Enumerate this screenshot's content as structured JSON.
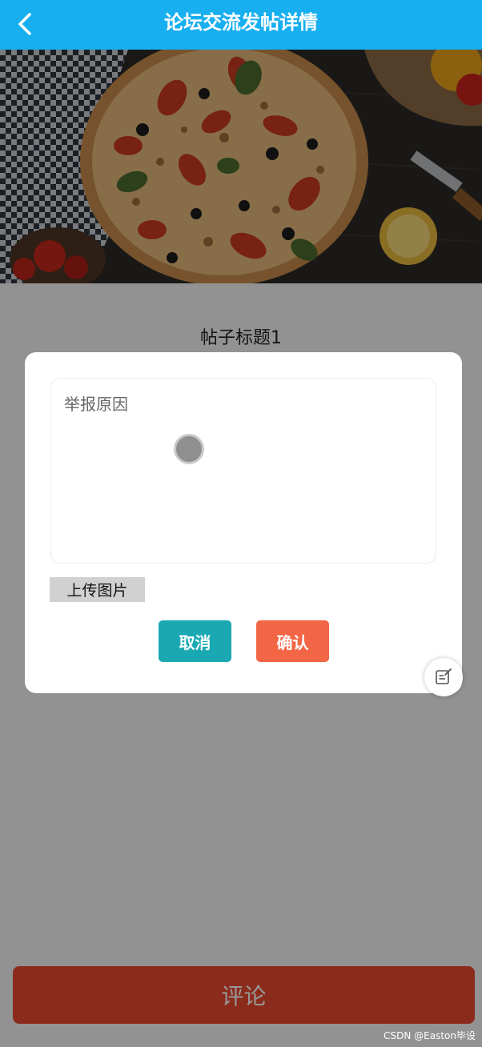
{
  "header": {
    "title": "论坛交流发帖详情",
    "back_icon": "chevron-left-icon"
  },
  "banner": {
    "image": "pizza-photo"
  },
  "post": {
    "title": "帖子标题1"
  },
  "dialog": {
    "reason_placeholder": "举报原因",
    "reason_value": "",
    "upload_label": "上传图片",
    "cancel_label": "取消",
    "confirm_label": "确认"
  },
  "comment_button": {
    "label": "评论"
  },
  "float_button": {
    "icon": "edit-note-icon"
  },
  "watermark": "CSDN @Easton毕设",
  "colors": {
    "header": "#17aff0",
    "cancel": "#1aa9b3",
    "confirm": "#f26545",
    "comment": "#e8482f"
  }
}
